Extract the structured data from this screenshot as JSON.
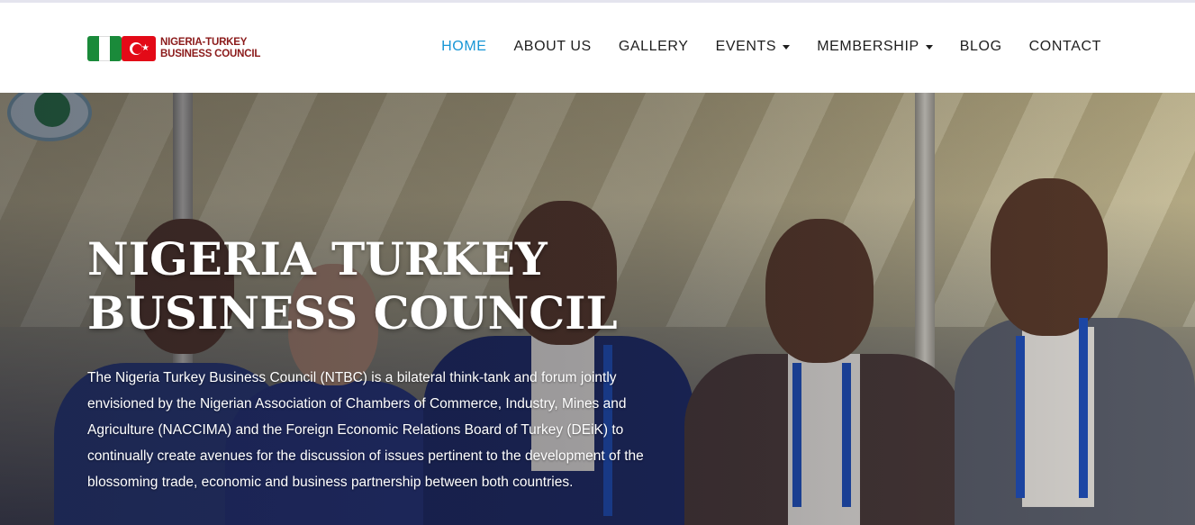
{
  "brand": {
    "name_line1": "NIGERIA-TURKEY",
    "name_line2": "BUSINESS COUNCIL",
    "flag_icons": [
      "nigeria-flag-icon",
      "turkey-flag-icon"
    ]
  },
  "nav": {
    "items": [
      {
        "label": "HOME",
        "active": true,
        "dropdown": false
      },
      {
        "label": "ABOUT US",
        "active": false,
        "dropdown": false
      },
      {
        "label": "GALLERY",
        "active": false,
        "dropdown": false
      },
      {
        "label": "EVENTS",
        "active": false,
        "dropdown": true
      },
      {
        "label": "MEMBERSHIP",
        "active": false,
        "dropdown": true
      },
      {
        "label": "BLOG",
        "active": false,
        "dropdown": false
      },
      {
        "label": "CONTACT",
        "active": false,
        "dropdown": false
      }
    ]
  },
  "hero": {
    "title_line1": "NIGERIA TURKEY",
    "title_line2": "BUSINESS COUNCIL",
    "lines": [
      "The Nigeria Turkey Business Council (NTBC) is a bilateral think-tank and forum jointly",
      "envisioned by the Nigerian Association of Chambers of Commerce, Industry, Mines and",
      "Agriculture (NACCIMA) and the Foreign Economic Relations Board of Turkey (DEiK) to",
      "continually create avenues for the discussion of issues pertinent to the development of the",
      "blossoming trade, economic and business partnership between both countries."
    ]
  },
  "colors": {
    "accent": "#1796d6",
    "nav_text": "#1e1e1e",
    "brand_text": "#8b1a1a"
  }
}
